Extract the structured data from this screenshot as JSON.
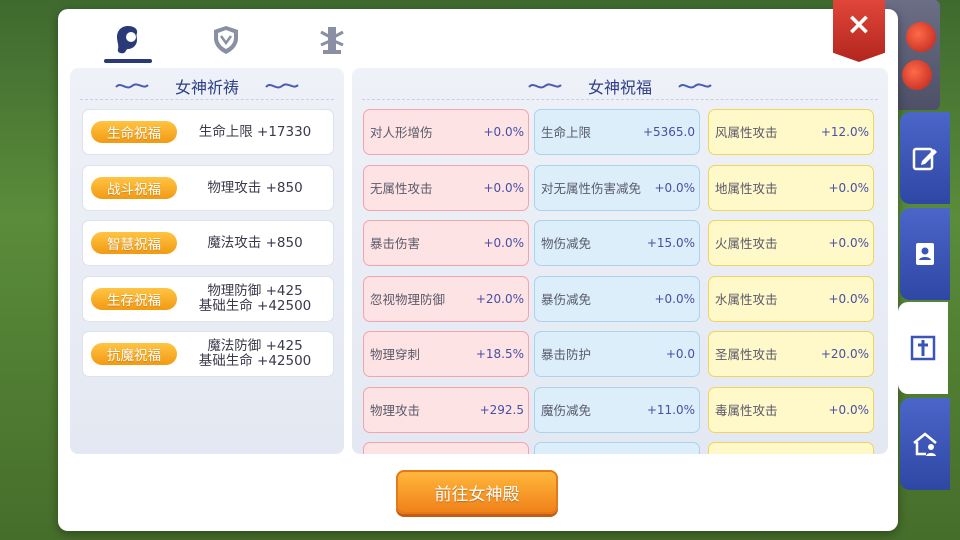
{
  "tabs": [
    {
      "icon": "goddess-head-icon",
      "active": true
    },
    {
      "icon": "shield-emblem-icon",
      "active": false
    },
    {
      "icon": "tower-icon",
      "active": false
    }
  ],
  "left": {
    "title": "女神祈祷",
    "blessings": [
      {
        "badge": "生命祝福",
        "effect": [
          "生命上限 +17330"
        ]
      },
      {
        "badge": "战斗祝福",
        "effect": [
          "物理攻击 +850"
        ]
      },
      {
        "badge": "智慧祝福",
        "effect": [
          "魔法攻击 +850"
        ]
      },
      {
        "badge": "生存祝福",
        "effect": [
          "物理防御 +425",
          "基础生命 +42500"
        ]
      },
      {
        "badge": "抗魔祝福",
        "effect": [
          "魔法防御 +425",
          "基础生命 +42500"
        ]
      }
    ]
  },
  "right": {
    "title": "女神祝福",
    "columns": [
      [
        {
          "name": "对人形增伤",
          "value": "+0.0%"
        },
        {
          "name": "无属性攻击",
          "value": "+0.0%"
        },
        {
          "name": "暴击伤害",
          "value": "+0.0%"
        },
        {
          "name": "忽视物理防御",
          "value": "+20.0%"
        },
        {
          "name": "物理穿刺",
          "value": "+18.5%"
        },
        {
          "name": "物理攻击",
          "value": "+292.5"
        }
      ],
      [
        {
          "name": "生命上限",
          "value": "+5365.0"
        },
        {
          "name": "对无属性伤害减免",
          "value": "+0.0%"
        },
        {
          "name": "物伤减免",
          "value": "+15.0%"
        },
        {
          "name": "暴伤减免",
          "value": "+0.0%"
        },
        {
          "name": "暴击防护",
          "value": "+0.0"
        },
        {
          "name": "魔伤减免",
          "value": "+11.0%"
        }
      ],
      [
        {
          "name": "风属性攻击",
          "value": "+12.0%"
        },
        {
          "name": "地属性攻击",
          "value": "+0.0%"
        },
        {
          "name": "火属性攻击",
          "value": "+0.0%"
        },
        {
          "name": "水属性攻击",
          "value": "+0.0%"
        },
        {
          "name": "圣属性攻击",
          "value": "+20.0%"
        },
        {
          "name": "毒属性攻击",
          "value": "+0.0%"
        }
      ]
    ]
  },
  "go_button": "前往女神殿",
  "close_label": "×",
  "side_tabs": [
    {
      "icon": "edit-icon",
      "active": false
    },
    {
      "icon": "contact-book-icon",
      "active": false
    },
    {
      "icon": "cross-icon",
      "active": true
    },
    {
      "icon": "guild-house-icon",
      "active": false
    }
  ],
  "colors": {
    "accent": "#2f3f86",
    "badge": "#f29a13",
    "close": "#c9332a",
    "side_tab": "#3a55b8"
  }
}
